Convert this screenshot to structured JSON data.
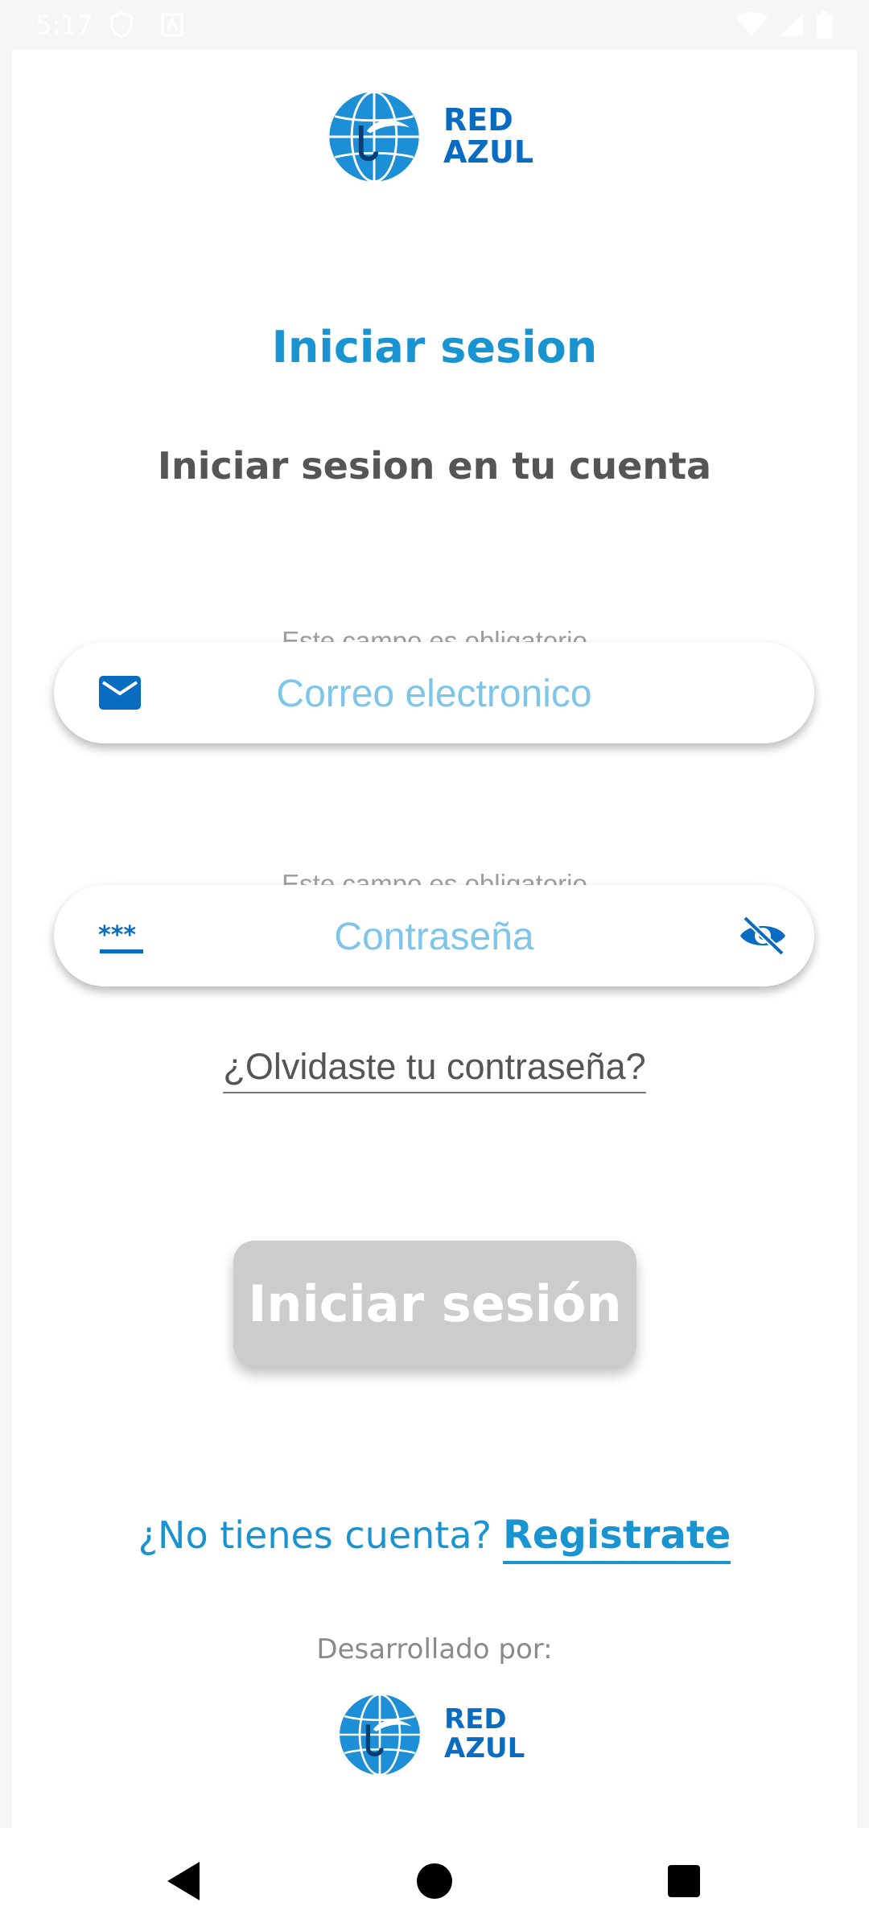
{
  "status_bar": {
    "time": "5:17",
    "icons": [
      "shield-icon",
      "notification-icon",
      "wifi-icon",
      "signal-icon",
      "battery-icon"
    ]
  },
  "brand": {
    "line1": "RED",
    "line2": "AZUL",
    "color": "#0a6cc0"
  },
  "login": {
    "title": "Iniciar sesion",
    "subtitle": "Iniciar sesion en tu cuenta",
    "email": {
      "helper": "Este campo es obligatorio",
      "placeholder": "Correo electronico",
      "value": "",
      "icon": "mail-icon"
    },
    "password": {
      "helper": "Este campo es obligatorio",
      "placeholder": "Contraseña",
      "value": "",
      "icon": "password-icon",
      "toggle_icon": "eye-off-icon"
    },
    "forgot_password": "¿Olvidaste tu contraseña?",
    "submit_label": "Iniciar sesión",
    "submit_color": "#cccccc"
  },
  "signup": {
    "prompt": "¿No tienes cuenta?",
    "link": "Registrate"
  },
  "footer": {
    "developed_by": "Desarrollado por:"
  },
  "colors": {
    "accent": "#1a93d1",
    "placeholder": "#7ec5ea",
    "icon": "#0a6cc0"
  },
  "nav": {
    "icons": [
      "back-icon",
      "home-icon",
      "recents-icon"
    ]
  }
}
